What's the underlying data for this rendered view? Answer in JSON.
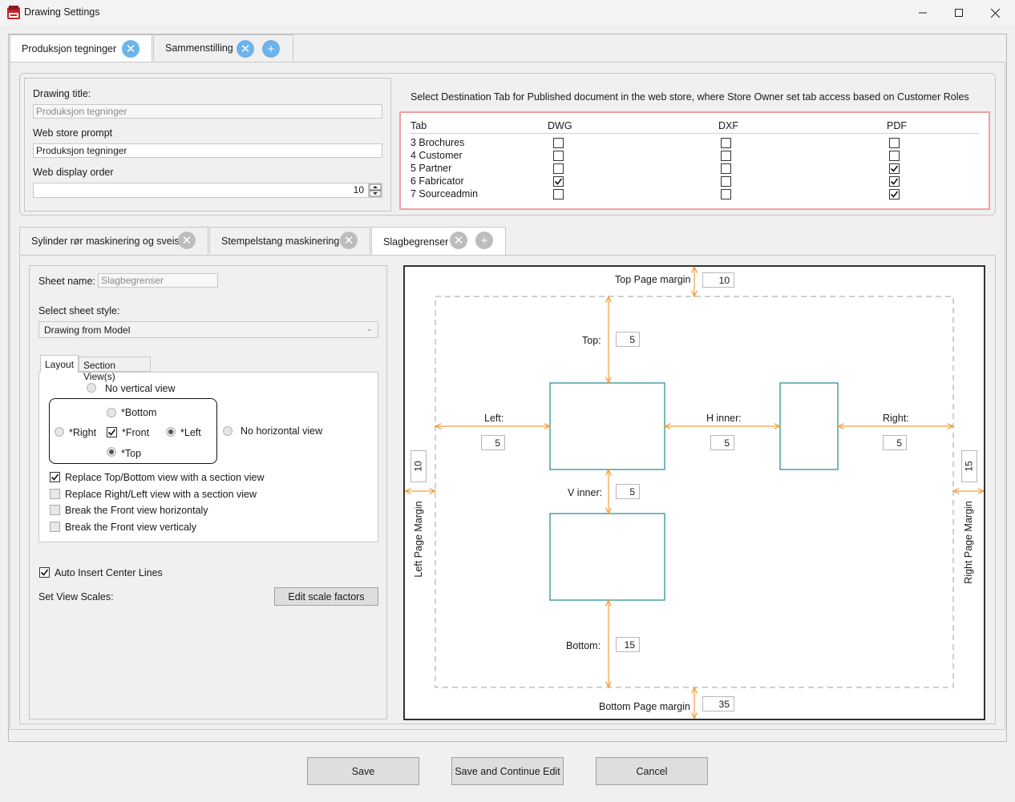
{
  "window": {
    "title": "Drawing Settings",
    "controls": {
      "minimize": "—",
      "maximize": "☐",
      "close": "✕"
    }
  },
  "top_tabs": [
    {
      "label": "Produksjon tegninger",
      "active": true
    },
    {
      "label": "Sammenstilling",
      "active": false
    }
  ],
  "drawing": {
    "title_label": "Drawing title:",
    "title_value": "Produksjon tegninger",
    "prompt_label": "Web store prompt",
    "prompt_value": "Produksjon tegninger",
    "order_label": "Web display order",
    "order_value": "10"
  },
  "destination": {
    "instruction": "Select Destination Tab for Published document in the web store, where Store Owner set tab access based on Customer Roles",
    "headers": {
      "tab": "Tab",
      "dwg": "DWG",
      "dxf": "DXF",
      "pdf": "PDF"
    },
    "rows": [
      {
        "name": "3 Brochures",
        "dwg": false,
        "dxf": false,
        "pdf": false
      },
      {
        "name": "4 Customer",
        "dwg": false,
        "dxf": false,
        "pdf": false
      },
      {
        "name": "5 Partner",
        "dwg": false,
        "dxf": false,
        "pdf": true
      },
      {
        "name": "6 Fabricator",
        "dwg": true,
        "dxf": false,
        "pdf": true
      },
      {
        "name": "7 Sourceadmin",
        "dwg": false,
        "dxf": false,
        "pdf": true
      }
    ]
  },
  "sheet_tabs": [
    {
      "label": "Sylinder rør maskinering og sveis",
      "active": false
    },
    {
      "label": "Stempelstang maskinering",
      "active": false
    },
    {
      "label": "Slagbegrenser",
      "active": true
    }
  ],
  "sheet": {
    "name_label": "Sheet name:",
    "name_value": "Slagbegrenser",
    "style_label": "Select sheet style:",
    "style_value": "Drawing from Model",
    "inner_tabs": [
      "Layout",
      "Section View(s)"
    ],
    "radios": {
      "no_vertical": "No vertical view",
      "bottom": "*Bottom",
      "right": "*Right",
      "front": "*Front",
      "left": "*Left",
      "top": "*Top",
      "no_horizontal": "No horizontal view"
    },
    "options": [
      {
        "label": "Replace Top/Bottom view with a section view",
        "checked": true
      },
      {
        "label": "Replace Right/Left view with a section view",
        "checked": false
      },
      {
        "label": "Break the Front view horizontaly",
        "checked": false
      },
      {
        "label": "Break the Front view verticaly",
        "checked": false
      }
    ],
    "auto_center_label": "Auto Insert Center Lines",
    "auto_center_checked": true,
    "scales_label": "Set View Scales:",
    "scale_button": "Edit scale factors"
  },
  "layout_diagram": {
    "top_page_margin_label": "Top Page margin",
    "top_page_margin": "10",
    "bottom_page_margin_label": "Bottom Page margin",
    "bottom_page_margin": "35",
    "left_page_margin_label": "Left Page Margin",
    "left_page_margin": "10",
    "right_page_margin_label": "Right Page Margin",
    "right_page_margin": "15",
    "top_label": "Top:",
    "top": "5",
    "left_label": "Left:",
    "left": "5",
    "h_inner_label": "H inner:",
    "h_inner": "5",
    "right_label": "Right:",
    "right": "5",
    "v_inner_label": "V inner:",
    "v_inner": "5",
    "bottom_label": "Bottom:",
    "bottom": "15",
    "accent_color": "#f0a040",
    "view_color": "#1a8a8a"
  },
  "footer": {
    "save": "Save",
    "save_continue": "Save and Continue Edit",
    "cancel": "Cancel"
  }
}
